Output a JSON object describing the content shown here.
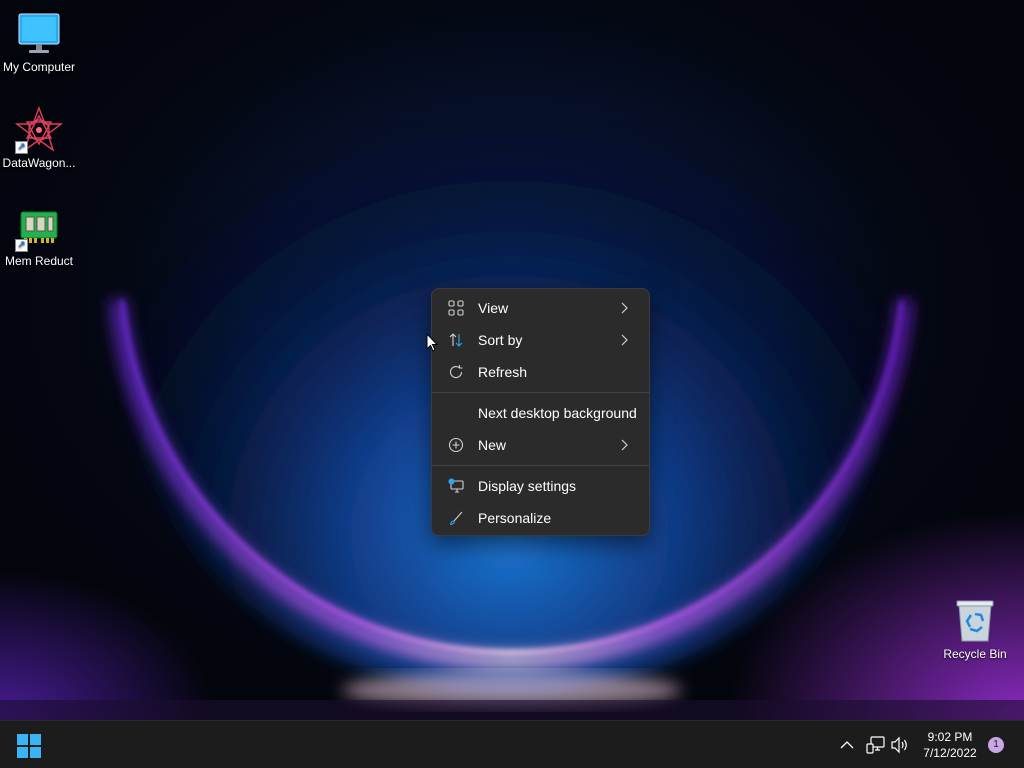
{
  "desktop": {
    "icons": [
      {
        "label": "My Computer",
        "icon": "monitor-icon"
      },
      {
        "label": "DataWagon...",
        "icon": "datawagon-app-icon",
        "shortcut": true
      },
      {
        "label": "Mem Reduct",
        "icon": "memory-chip-icon",
        "shortcut": true
      }
    ],
    "recycle_bin": {
      "label": "Recycle Bin",
      "icon": "recycle-bin-icon"
    }
  },
  "context_menu": {
    "items": [
      {
        "label": "View",
        "icon": "grid-view-icon",
        "submenu": true
      },
      {
        "label": "Sort by",
        "icon": "sort-arrows-icon",
        "submenu": true
      },
      {
        "label": "Refresh",
        "icon": "refresh-icon",
        "submenu": false
      },
      {
        "label": "Next desktop background",
        "icon": "",
        "submenu": false
      },
      {
        "label": "New",
        "icon": "plus-circle-icon",
        "submenu": true
      },
      {
        "label": "Display settings",
        "icon": "display-settings-icon",
        "submenu": false
      },
      {
        "label": "Personalize",
        "icon": "brush-icon",
        "submenu": false
      }
    ]
  },
  "taskbar": {
    "start_icon": "windows-logo-icon",
    "tray": {
      "icons": [
        "chevron-up-icon",
        "network-icon",
        "volume-icon"
      ],
      "time": "9:02 PM",
      "date": "7/12/2022",
      "notification_count": "1"
    }
  },
  "colors": {
    "menu_bg": "#2b2b2b",
    "taskbar_bg": "#1c1c1c",
    "accent_blue": "#2aa8f2",
    "badge": "#c9a6e6"
  }
}
